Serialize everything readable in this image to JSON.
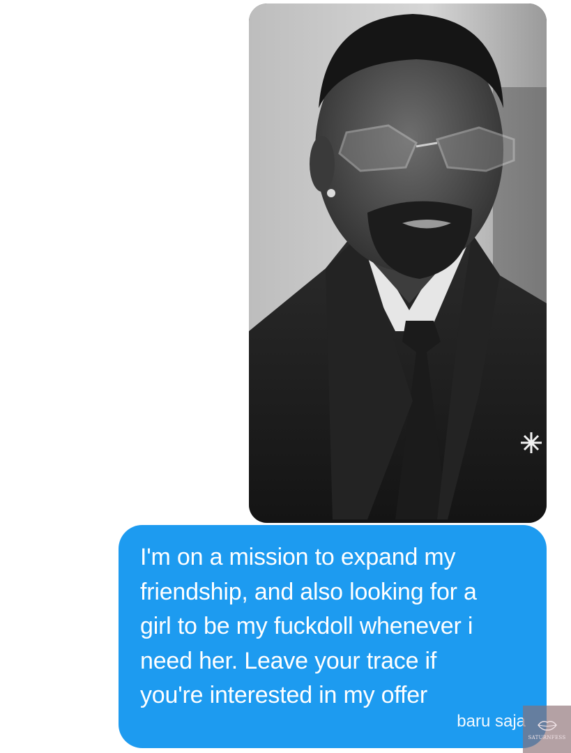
{
  "message": {
    "image_alt": "black-and-white portrait of a man with glasses in a suit",
    "text": "I'm on a mission to expand my\nfriendship, and also looking for a\ngirl to be my fuckdoll whenever i\nneed her. Leave your trace if\nyou're interested in my offer",
    "timestamp": "baru saja",
    "bubble_color": "#1d9bf0"
  },
  "watermark": {
    "text": "SATURNFESS",
    "icon": "lips-icon"
  }
}
